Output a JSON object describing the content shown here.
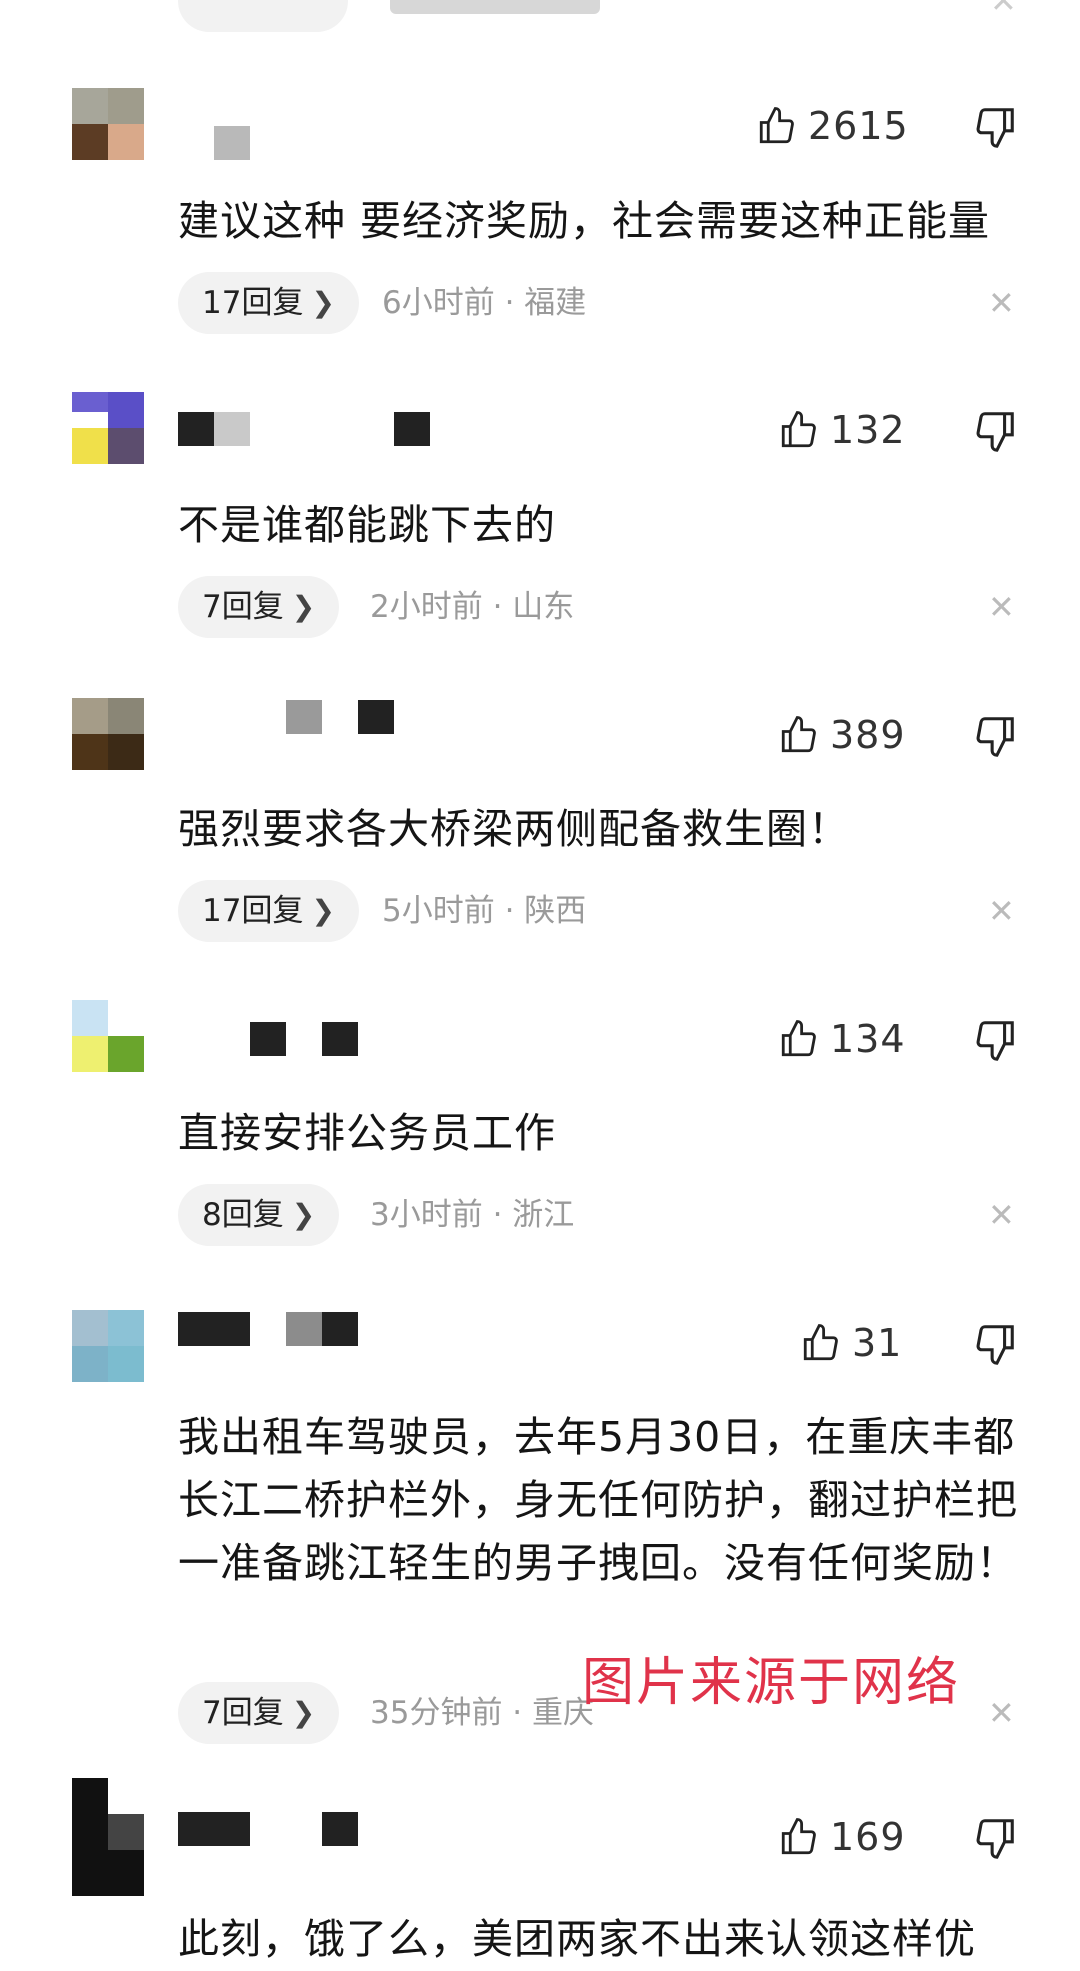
{
  "comments": [
    {
      "likes": "2615",
      "text": "建议这种 要经济奖励，社会需要这种正能量",
      "replies": "17回复",
      "meta": "6小时前 · 福建"
    },
    {
      "likes": "132",
      "text": "不是谁都能跳下去的",
      "replies": "7回复",
      "meta": "2小时前 · 山东"
    },
    {
      "likes": "389",
      "text": "强烈要求各大桥梁两侧配备救生圈！",
      "replies": "17回复",
      "meta": "5小时前 · 陕西"
    },
    {
      "likes": "134",
      "text": "直接安排公务员工作",
      "replies": "8回复",
      "meta": "3小时前 · 浙江"
    },
    {
      "likes": "31",
      "text": "我出租车驾驶员，去年5月30日，在重庆丰都长江二桥护栏外，身无任何防护，翻过护栏把一准备跳江轻生的男子拽回。没有任何奖励！",
      "replies": "7回复",
      "meta": "35分钟前 · 重庆"
    },
    {
      "likes": "169",
      "text": "此刻，饿了么，美团两家不出来认领这样优"
    }
  ],
  "watermark": "图片来源于网络",
  "icons": {
    "like": "thumbs-up-icon",
    "dislike": "thumbs-down-icon",
    "reply": "chevron-right-icon",
    "close": "close-icon"
  }
}
